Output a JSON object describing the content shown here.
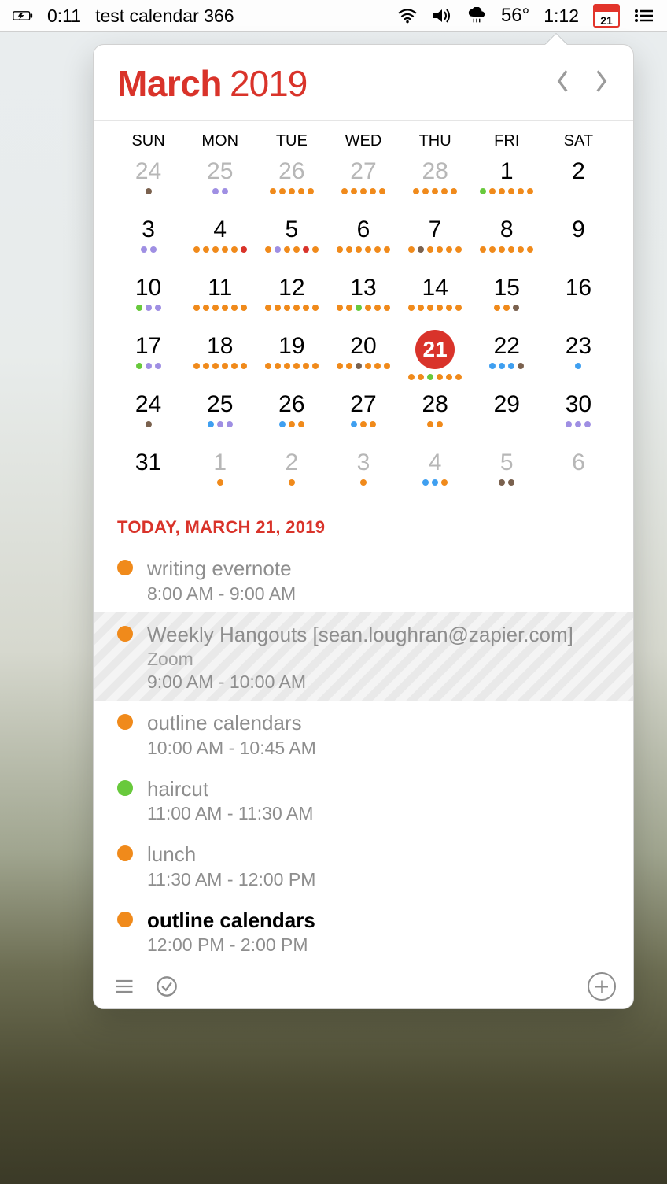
{
  "menubar": {
    "timer": "0:11",
    "title": "test calendar 366",
    "temp": "56°",
    "clock": "1:12",
    "cal_num": "21"
  },
  "header": {
    "month": "March",
    "year": "2019"
  },
  "dow": [
    "SUN",
    "MON",
    "TUE",
    "WED",
    "THU",
    "FRI",
    "SAT"
  ],
  "colors": {
    "orange": "#f08a1b",
    "green": "#68c93c",
    "blue": "#3f9ff0",
    "purple": "#9f8fe3",
    "brown": "#7a614e",
    "gray": "#b0b0b0",
    "red": "#d9332a"
  },
  "cells": [
    {
      "n": "24",
      "out": true,
      "dots": [
        "brown"
      ]
    },
    {
      "n": "25",
      "out": true,
      "dots": [
        "purple",
        "purple"
      ]
    },
    {
      "n": "26",
      "out": true,
      "dots": [
        "orange",
        "orange",
        "orange",
        "orange",
        "orange"
      ]
    },
    {
      "n": "27",
      "out": true,
      "dots": [
        "orange",
        "orange",
        "orange",
        "orange",
        "orange"
      ]
    },
    {
      "n": "28",
      "out": true,
      "dots": [
        "orange",
        "orange",
        "orange",
        "orange",
        "orange"
      ]
    },
    {
      "n": "1",
      "dots": [
        "green",
        "orange",
        "orange",
        "orange",
        "orange",
        "orange"
      ]
    },
    {
      "n": "2",
      "dots": []
    },
    {
      "n": "3",
      "dots": [
        "purple",
        "purple"
      ]
    },
    {
      "n": "4",
      "dots": [
        "orange",
        "orange",
        "orange",
        "orange",
        "orange",
        "red"
      ]
    },
    {
      "n": "5",
      "dots": [
        "orange",
        "purple",
        "orange",
        "orange",
        "red",
        "orange"
      ]
    },
    {
      "n": "6",
      "dots": [
        "orange",
        "orange",
        "orange",
        "orange",
        "orange",
        "orange"
      ]
    },
    {
      "n": "7",
      "dots": [
        "orange",
        "brown",
        "orange",
        "orange",
        "orange",
        "orange"
      ]
    },
    {
      "n": "8",
      "dots": [
        "orange",
        "orange",
        "orange",
        "orange",
        "orange",
        "orange"
      ]
    },
    {
      "n": "9",
      "dots": []
    },
    {
      "n": "10",
      "dots": [
        "green",
        "purple",
        "purple"
      ]
    },
    {
      "n": "11",
      "dots": [
        "orange",
        "orange",
        "orange",
        "orange",
        "orange",
        "orange"
      ]
    },
    {
      "n": "12",
      "dots": [
        "orange",
        "orange",
        "orange",
        "orange",
        "orange",
        "orange"
      ]
    },
    {
      "n": "13",
      "dots": [
        "orange",
        "orange",
        "green",
        "orange",
        "orange",
        "orange"
      ]
    },
    {
      "n": "14",
      "dots": [
        "orange",
        "orange",
        "orange",
        "orange",
        "orange",
        "orange"
      ]
    },
    {
      "n": "15",
      "dots": [
        "orange",
        "orange",
        "brown"
      ]
    },
    {
      "n": "16",
      "dots": []
    },
    {
      "n": "17",
      "dots": [
        "green",
        "purple",
        "purple"
      ]
    },
    {
      "n": "18",
      "dots": [
        "orange",
        "orange",
        "orange",
        "orange",
        "orange",
        "orange"
      ]
    },
    {
      "n": "19",
      "dots": [
        "orange",
        "orange",
        "orange",
        "orange",
        "orange",
        "orange"
      ]
    },
    {
      "n": "20",
      "dots": [
        "orange",
        "orange",
        "brown",
        "orange",
        "orange",
        "orange"
      ]
    },
    {
      "n": "21",
      "today": true,
      "dots": [
        "orange",
        "orange",
        "green",
        "orange",
        "orange",
        "orange"
      ]
    },
    {
      "n": "22",
      "dots": [
        "blue",
        "blue",
        "blue",
        "brown"
      ]
    },
    {
      "n": "23",
      "dots": [
        "blue"
      ]
    },
    {
      "n": "24",
      "dots": [
        "brown"
      ]
    },
    {
      "n": "25",
      "dots": [
        "blue",
        "purple",
        "purple"
      ]
    },
    {
      "n": "26",
      "dots": [
        "blue",
        "orange",
        "orange"
      ]
    },
    {
      "n": "27",
      "dots": [
        "blue",
        "orange",
        "orange"
      ]
    },
    {
      "n": "28",
      "dots": [
        "orange",
        "orange"
      ]
    },
    {
      "n": "29",
      "dots": []
    },
    {
      "n": "30",
      "dots": [
        "purple",
        "purple",
        "purple"
      ]
    },
    {
      "n": "31",
      "dots": []
    },
    {
      "n": "1",
      "out": true,
      "dots": [
        "orange"
      ]
    },
    {
      "n": "2",
      "out": true,
      "dots": [
        "orange"
      ]
    },
    {
      "n": "3",
      "out": true,
      "dots": [
        "orange"
      ]
    },
    {
      "n": "4",
      "out": true,
      "dots": [
        "blue",
        "blue",
        "orange"
      ]
    },
    {
      "n": "5",
      "out": true,
      "dots": [
        "brown",
        "brown"
      ]
    },
    {
      "n": "6",
      "out": true,
      "dots": []
    }
  ],
  "today_label": "TODAY, MARCH 21, 2019",
  "events": [
    {
      "color": "orange",
      "title": "writing evernote",
      "time": "8:00 AM - 9:00 AM"
    },
    {
      "color": "orange",
      "title": "Weekly Hangouts [sean.loughran@zapier.com]",
      "sub": "Zoom",
      "time": "9:00 AM - 10:00 AM",
      "striped": true
    },
    {
      "color": "orange",
      "title": "outline calendars",
      "time": "10:00 AM - 10:45 AM"
    },
    {
      "color": "green",
      "title": "haircut",
      "time": "11:00 AM - 11:30 AM"
    },
    {
      "color": "orange",
      "title": "lunch",
      "time": "11:30 AM - 12:00 PM"
    },
    {
      "color": "orange",
      "title": "outline calendars",
      "time": "12:00 PM - 2:00 PM",
      "strong": true
    }
  ]
}
